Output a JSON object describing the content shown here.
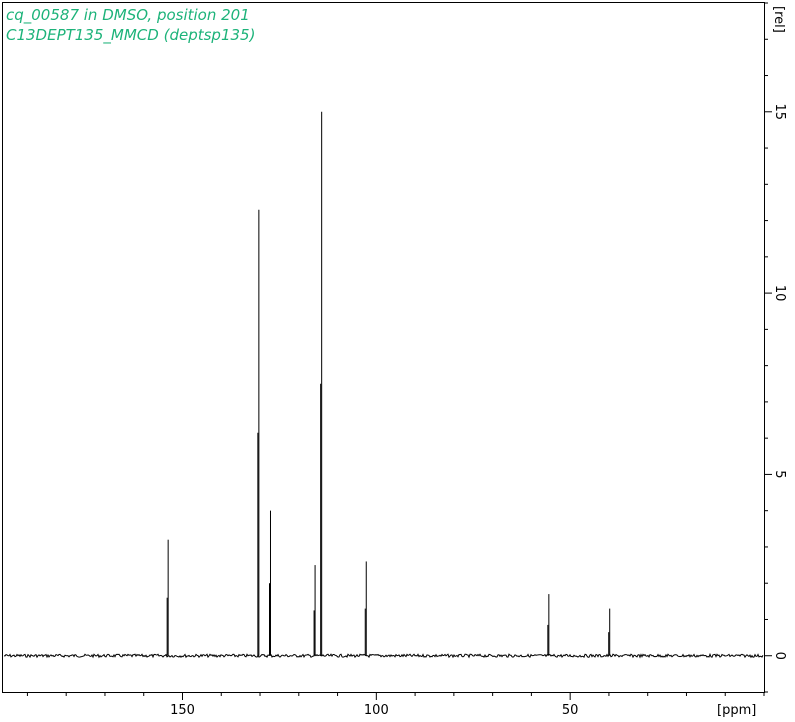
{
  "chart_data": {
    "type": "line",
    "title_lines": [
      "cq_00587 in DMSO, position 201",
      "C13DEPT135_MMCD (deptsp135)"
    ],
    "x_unit": "[ppm]",
    "y_unit": "[rel]",
    "x_range": [
      196.3,
      0
    ],
    "x_reversed": true,
    "y_range": [
      -1.0,
      18.0
    ],
    "x_major_ticks": [
      150,
      100,
      50
    ],
    "x_minor_step": 10,
    "y_major_ticks": [
      0,
      5,
      10,
      15
    ],
    "y_minor_step": 1,
    "baseline": 0,
    "peaks": [
      {
        "ppm": 153.7,
        "height": 3.2
      },
      {
        "ppm": 130.3,
        "height": 12.3
      },
      {
        "ppm": 127.3,
        "height": 4.0
      },
      {
        "ppm": 115.8,
        "height": 2.5
      },
      {
        "ppm": 114.1,
        "height": 15.0
      },
      {
        "ppm": 102.6,
        "height": 2.6
      },
      {
        "ppm": 55.5,
        "height": 1.7
      },
      {
        "ppm": 39.8,
        "height": 1.3
      }
    ],
    "colors": {
      "spectrum": "#000000",
      "title": "#1db37a",
      "axes": "#000000"
    }
  }
}
